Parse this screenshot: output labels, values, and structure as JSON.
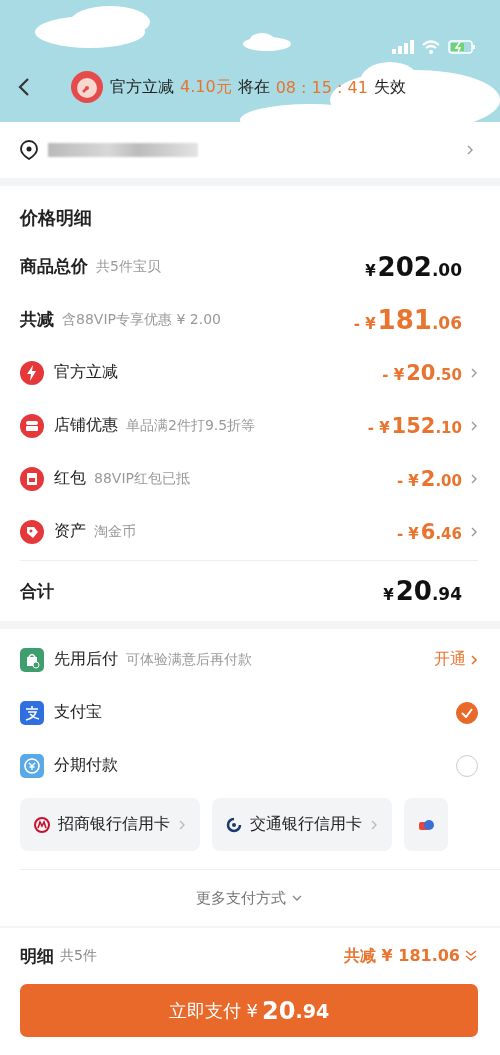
{
  "promo_bar": {
    "label": "官方立减",
    "amount": "4.10元",
    "middle": "将在",
    "countdown": "08 : 15 : 41",
    "suffix": "失效"
  },
  "price_detail": {
    "title": "价格明细",
    "rows": [
      {
        "kind": "subtotal",
        "label": "商品总价",
        "note": "共5件宝贝",
        "prefix": "¥",
        "integer": "202",
        "decimal": ".00"
      },
      {
        "kind": "reduction",
        "label": "共减",
        "note": "含88VIP专享优惠 ¥ 2.00",
        "prefix": "- ¥",
        "integer": "181",
        "decimal": ".06"
      },
      {
        "kind": "discount",
        "label": "官方立减",
        "prefix": "- ¥",
        "integer": "20",
        "decimal": ".50"
      },
      {
        "kind": "discount",
        "label": "店铺优惠",
        "note": "单品满2件打9.5折等",
        "prefix": "- ¥",
        "integer": "152",
        "decimal": ".10"
      },
      {
        "kind": "discount",
        "label": "红包",
        "note": "88VIP红包已抵",
        "prefix": "- ¥",
        "integer": "2",
        "decimal": ".00"
      },
      {
        "kind": "discount",
        "label": "资产",
        "note": "淘金币",
        "prefix": "- ¥",
        "integer": "6",
        "decimal": ".46"
      }
    ],
    "total": {
      "label": "合计",
      "prefix": "¥",
      "integer": "20",
      "decimal": ".94"
    }
  },
  "payment": {
    "methods": [
      {
        "kind": "link",
        "label": "先用后付",
        "note": "可体验满意后再付款",
        "action": "开通"
      },
      {
        "kind": "radio",
        "label": "支付宝",
        "selected": true
      },
      {
        "kind": "radio",
        "label": "分期付款",
        "selected": false
      }
    ],
    "cards": [
      {
        "kind": "bank",
        "label": "招商银行信用卡"
      },
      {
        "kind": "bank",
        "label": "交通银行信用卡"
      },
      {
        "kind": "partial"
      }
    ],
    "more": "更多支付方式"
  },
  "footer": {
    "label": "明细",
    "count": "共5件",
    "discount": "共减 ¥ 181.06",
    "pay_label": "立即支付 ¥",
    "pay_integer": "20",
    "pay_decimal": ".94"
  }
}
